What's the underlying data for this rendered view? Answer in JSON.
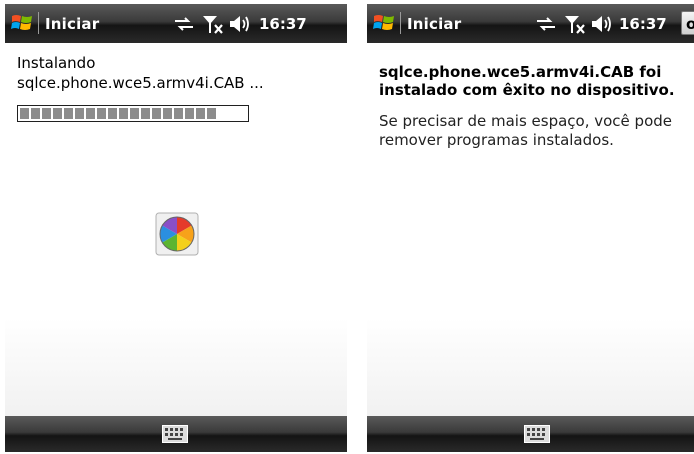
{
  "screens": [
    {
      "title": "Iniciar",
      "clock": "16:37",
      "install_label": "Instalando",
      "install_file": "sqlce.phone.wce5.armv4i.CAB ...",
      "progress_fraction": 0.86,
      "icons": [
        "windows-start-flag-icon",
        "sync-arrows-icon",
        "no-signal-icon",
        "speaker-icon",
        "busy-wheel-icon",
        "keyboard-icon"
      ]
    },
    {
      "title": "Iniciar",
      "clock": "16:37",
      "ok_label": "ok",
      "success_message": "sqlce.phone.wce5.armv4i.CAB foi instalado com êxito no dispositivo.",
      "hint_message": "Se precisar de mais espaço, você pode remover programas instalados.",
      "icons": [
        "windows-start-flag-icon",
        "sync-arrows-icon",
        "no-signal-icon",
        "speaker-icon",
        "keyboard-icon"
      ]
    }
  ]
}
